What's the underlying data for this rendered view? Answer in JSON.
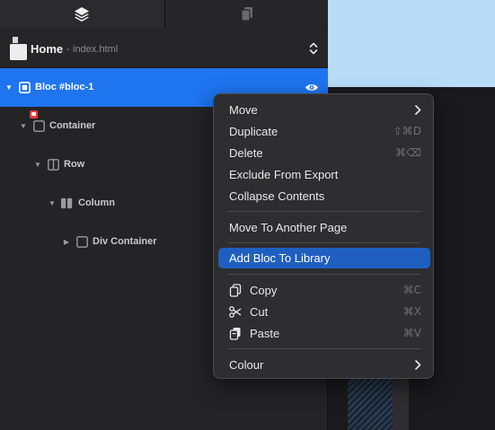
{
  "panel": {
    "tabs": [
      {
        "name": "layers",
        "icon": "layers-icon"
      },
      {
        "name": "pages",
        "icon": "copy-pages-icon"
      }
    ],
    "page_select": {
      "title": "Home",
      "separator": "-",
      "file": "index.html"
    }
  },
  "tree": {
    "items": [
      {
        "label": "Bloc #bloc-1",
        "selected": true
      },
      {
        "label": "Container"
      },
      {
        "label": "Row"
      },
      {
        "label": "Column"
      },
      {
        "label": "Div Container"
      }
    ]
  },
  "menu": {
    "move": "Move",
    "duplicate": "Duplicate",
    "duplicate_shortcut": "⇧⌘D",
    "delete": "Delete",
    "delete_shortcut": "⌘⌫",
    "exclude": "Exclude From Export",
    "collapse": "Collapse Contents",
    "move_page": "Move To Another Page",
    "add_library": "Add Bloc To Library",
    "copy": "Copy",
    "copy_shortcut": "⌘C",
    "cut": "Cut",
    "cut_shortcut": "⌘X",
    "paste": "Paste",
    "paste_shortcut": "⌘V",
    "colour": "Colour"
  },
  "colors": {
    "selection": "#1f74f0",
    "menu_highlight": "#1e5fbf",
    "canvas_top": "#b9dcf7",
    "lock": "#e33a3a"
  }
}
